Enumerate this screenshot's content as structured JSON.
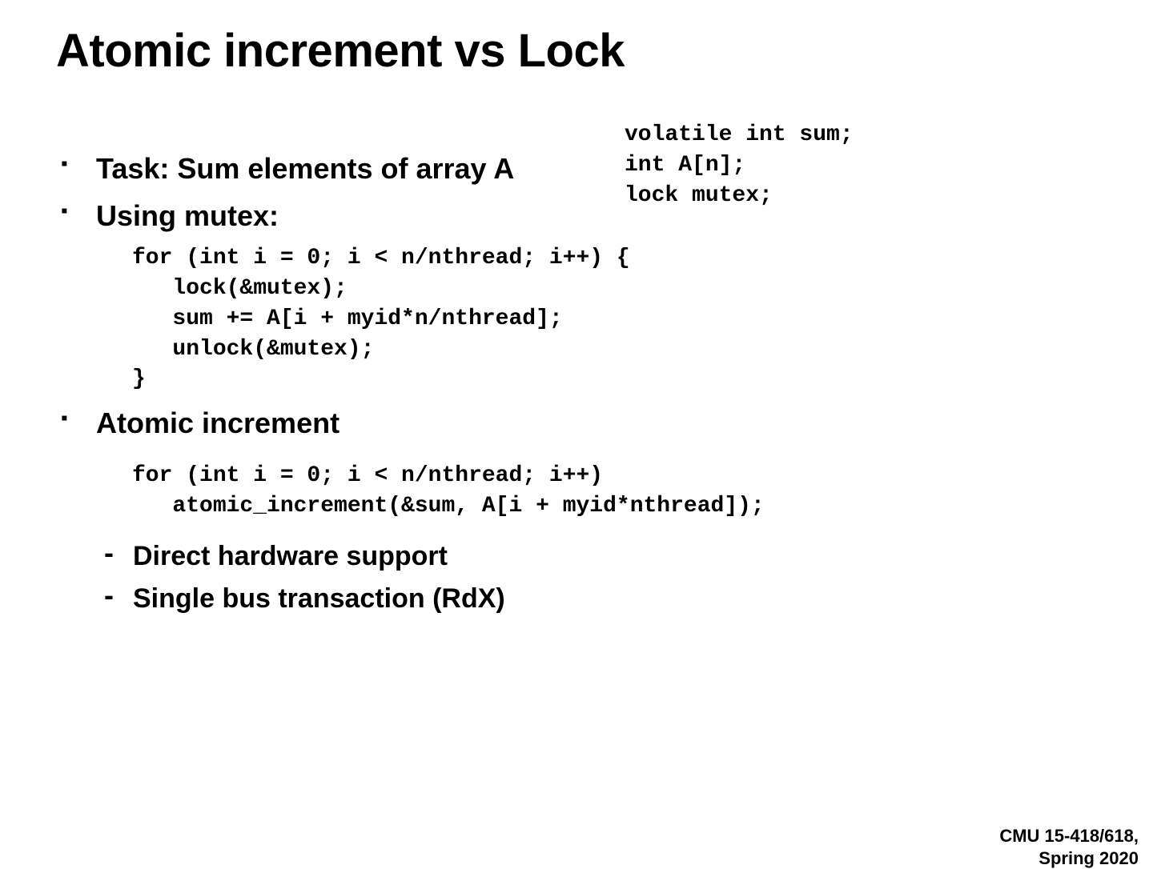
{
  "title": "Atomic increment vs Lock",
  "declarations": "volatile int sum;\nint A[n];\nlock mutex;",
  "bullets": {
    "b1": "Task: Sum elements of array  A",
    "b2": "Using mutex:",
    "b3": "Atomic increment"
  },
  "code": {
    "mutex": "for (int i = 0; i < n/nthread; i++) {\n   lock(&mutex);\n   sum += A[i + myid*n/nthread];\n   unlock(&mutex);\n}",
    "atomic": "for (int i = 0; i < n/nthread; i++)\n   atomic_increment(&sum, A[i + myid*nthread]);"
  },
  "sub": {
    "s1": "Direct hardware support",
    "s2": "Single bus transaction (RdX)"
  },
  "footer": {
    "course": "CMU 15-418/618,",
    "term": "Spring 2020"
  }
}
